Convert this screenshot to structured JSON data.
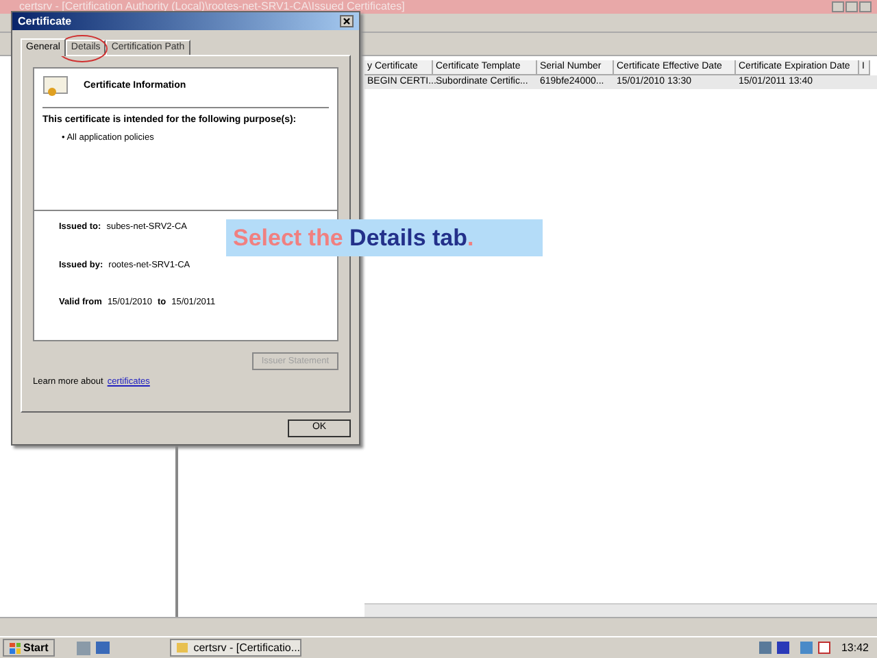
{
  "main_window": {
    "title": "certsrv - [Certification Authority (Local)\\rootes-net-SRV1-CA\\Issued Certificates]",
    "columns": [
      "y Certificate",
      "Certificate Template",
      "Serial Number",
      "Certificate Effective Date",
      "Certificate Expiration Date",
      "I"
    ],
    "rows": [
      [
        "BEGIN CERTI...",
        "Subordinate Certific...",
        "619bfe24000...",
        "15/01/2010 13:30",
        "15/01/2011 13:40"
      ]
    ]
  },
  "dialog": {
    "title": "Certificate",
    "tabs": [
      {
        "label": "General",
        "selected": true
      },
      {
        "label": "Details",
        "selected": false
      },
      {
        "label": "Certification Path",
        "selected": false
      }
    ],
    "heading": "Certificate Information",
    "purpose_title": "This certificate is intended for the following purpose(s):",
    "purposes": [
      "• All application policies"
    ],
    "issued_to_label": "Issued to:",
    "issued_to": "subes-net-SRV2-CA",
    "issued_by_label": "Issued by:",
    "issued_by": "rootes-net-SRV1-CA",
    "valid_from_label": "Valid from",
    "valid_from": "15/01/2010",
    "to_label": "to",
    "valid_to": "15/01/2011",
    "issuer_statement": {
      "label": "Issuer Statement",
      "disabled": true
    },
    "learn_more": "Learn more about",
    "learn_link": "certificates",
    "ok": "OK"
  },
  "callout": {
    "parts": [
      {
        "text": "Select the",
        "kind": "plain"
      },
      {
        "text": "Details tab",
        "kind": "emphasis"
      },
      {
        "text": ".",
        "kind": "plain"
      }
    ]
  },
  "taskbar": {
    "start": "Start",
    "task": "certsrv - [Certificatio...",
    "clock": "13:42"
  }
}
